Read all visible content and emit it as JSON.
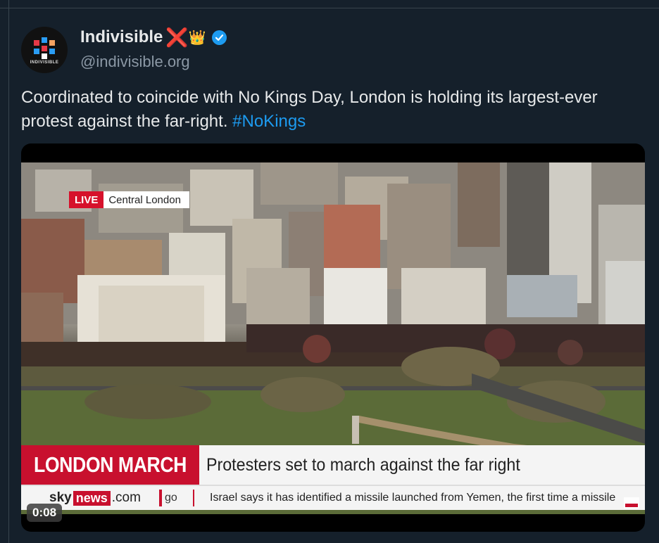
{
  "author": {
    "display_name": "Indivisible",
    "emoji_x": "❌",
    "emoji_crown": "👑",
    "handle": "@indivisible.org",
    "avatar_caption": "INDIVISIBLE",
    "verified_color": "#1d9bf0"
  },
  "tweet": {
    "text": "Coordinated to coincide with No Kings Day, London is holding its largest-ever protest against the far-right.",
    "hashtag": "#NoKings"
  },
  "video": {
    "live_label": "LIVE",
    "location": "Central London",
    "banner_title": "LONDON MARCH",
    "headline": "Protesters set to march against the far right",
    "brand_sky": "sky",
    "brand_news": "news",
    "brand_domain": ".com",
    "ticker_go": "go",
    "ticker_text": "Israel says it has identified a missile launched from Yemen, the first time a missile",
    "timestamp": "0:08"
  },
  "colors": {
    "background": "#15202b",
    "link": "#1d9bf0",
    "sky_red": "#c8102e"
  }
}
